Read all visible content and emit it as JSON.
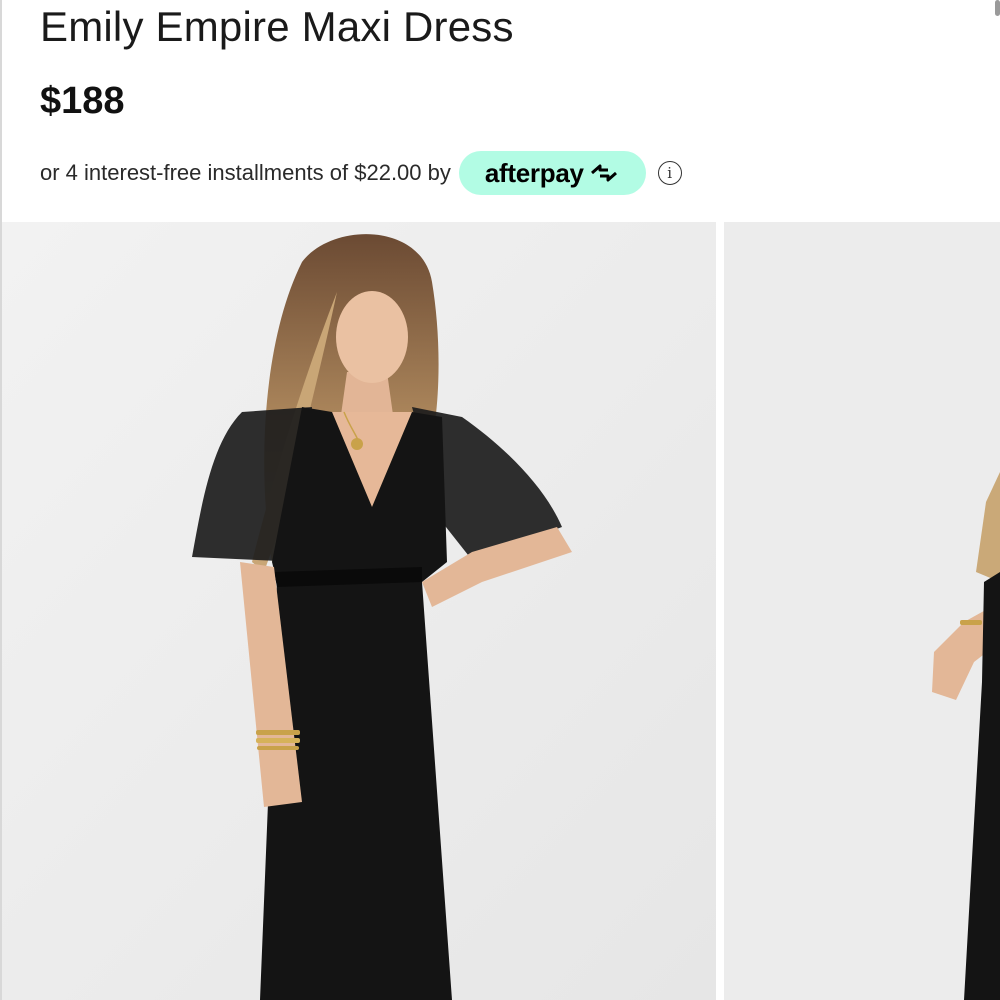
{
  "product": {
    "title": "Emily Empire Maxi Dress",
    "price": "$188"
  },
  "payment": {
    "installments_text": "or 4 interest-free installments of $22.00 by",
    "provider_label": "afterpay",
    "provider_color": "#b2fce4",
    "info_icon_glyph": "i"
  },
  "gallery": {
    "images": [
      {
        "icon": "model-photo-front"
      },
      {
        "icon": "model-photo-side"
      }
    ]
  }
}
